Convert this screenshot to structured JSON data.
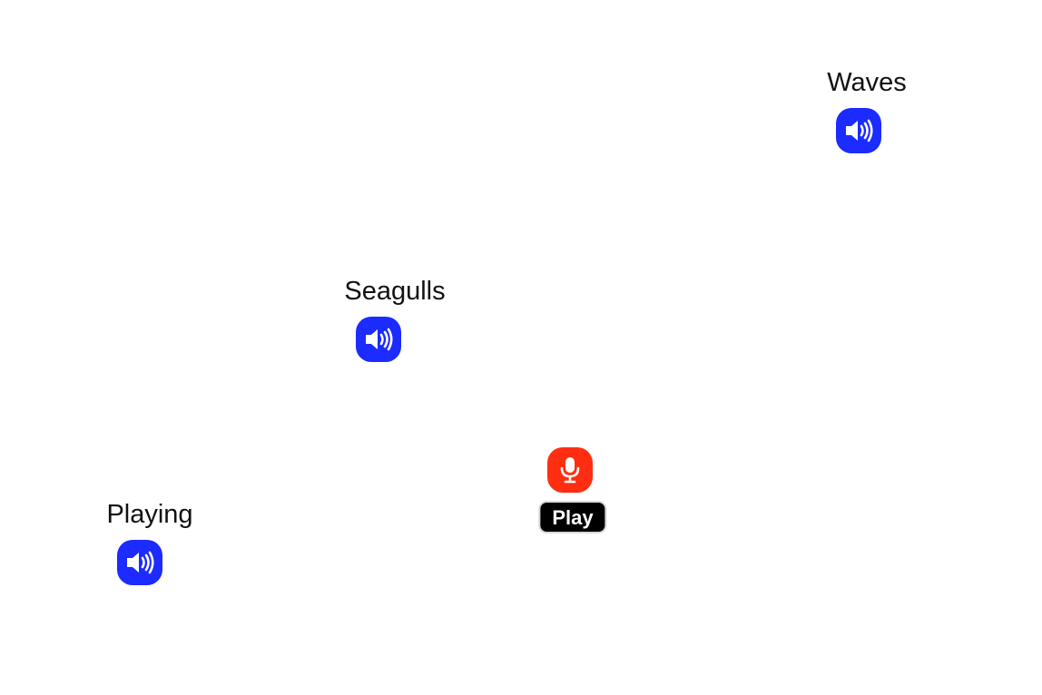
{
  "sources": [
    {
      "label": "Waves",
      "icon": "speaker-icon",
      "color": "#1c2bff"
    },
    {
      "label": "Seagulls",
      "icon": "speaker-icon",
      "color": "#1c2bff"
    },
    {
      "label": "Playing",
      "icon": "speaker-icon",
      "color": "#1c2bff"
    }
  ],
  "listener": {
    "icon": "microphone-icon",
    "color": "#ff2e12",
    "play_label": "Play"
  }
}
